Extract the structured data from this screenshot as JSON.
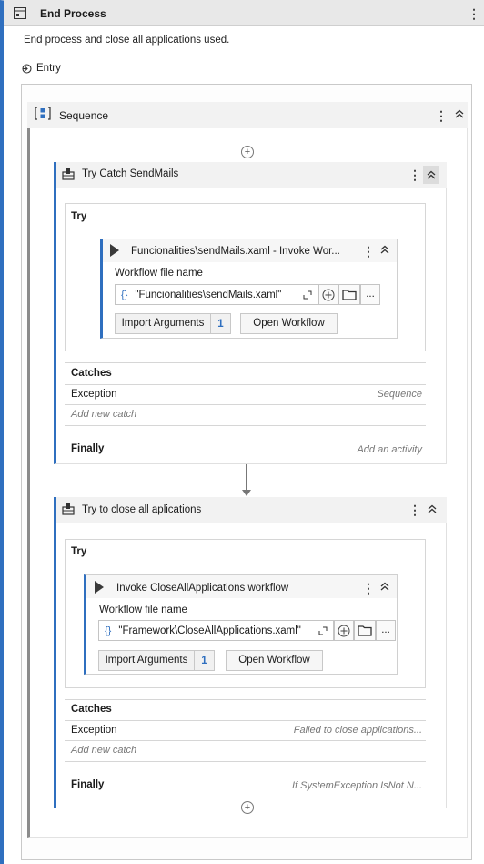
{
  "activity": {
    "title": "End Process",
    "description": "End process and close all applications used.",
    "entry_label": "Entry"
  },
  "sequence": {
    "title": "Sequence"
  },
  "try_catch_1": {
    "title": "Try Catch SendMails",
    "try_label": "Try",
    "invoke": {
      "title": "Funcionalities\\sendMails.xaml - Invoke Wor...",
      "file_label": "Workflow file name",
      "file_value": "\"Funcionalities\\sendMails.xaml\"",
      "import_label": "Import Arguments",
      "import_count": "1",
      "open_label": "Open Workflow",
      "ellipsis": "..."
    },
    "catches_label": "Catches",
    "exception_label": "Exception",
    "exception_handler": "Sequence",
    "add_catch": "Add new catch",
    "finally_label": "Finally",
    "finally_value": "Add an activity"
  },
  "try_catch_2": {
    "title": "Try to close all aplications",
    "try_label": "Try",
    "invoke": {
      "title": "Invoke CloseAllApplications workflow",
      "file_label": "Workflow file name",
      "file_value": "\"Framework\\CloseAllApplications.xaml\"",
      "import_label": "Import Arguments",
      "import_count": "1",
      "open_label": "Open Workflow",
      "ellipsis": "..."
    },
    "catches_label": "Catches",
    "exception_label": "Exception",
    "exception_handler": "Failed to close applications...",
    "add_catch": "Add new catch",
    "finally_label": "Finally",
    "finally_value": "If SystemException IsNot N..."
  },
  "icons": {
    "kebab": "⋮",
    "collapse": "≈",
    "plus": "+",
    "entry": "⮌",
    "brace": "{}",
    "expand": "⌞⌝",
    "trycatch": "🗳",
    "sequence": "[↕]"
  },
  "colors": {
    "accent": "#2f6fbf",
    "header_bg": "#e8e8e8"
  }
}
